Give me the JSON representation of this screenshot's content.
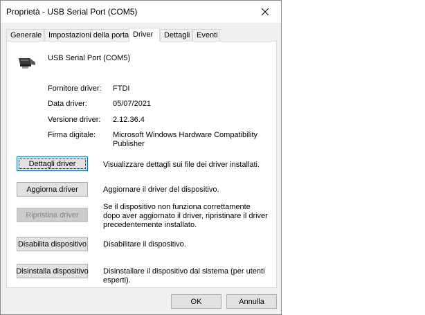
{
  "window": {
    "title": "Proprietà - USB Serial Port (COM5)",
    "close_icon": "close-icon"
  },
  "tabs": [
    {
      "label": "Generale"
    },
    {
      "label": "Impostazioni della porta"
    },
    {
      "label": "Driver",
      "selected": true
    },
    {
      "label": "Dettagli"
    },
    {
      "label": "Eventi"
    }
  ],
  "device": {
    "name": "USB Serial Port (COM5)",
    "icon": "usb-connector-icon"
  },
  "properties": [
    {
      "label": "Fornitore driver:",
      "value": "FTDI"
    },
    {
      "label": "Data driver:",
      "value": "05/07/2021"
    },
    {
      "label": "Versione driver:",
      "value": "2.12.36.4"
    },
    {
      "label": "Firma digitale:",
      "value": "Microsoft Windows Hardware Compatibility Publisher"
    }
  ],
  "actions": [
    {
      "label": "Dettagli driver",
      "description": "Visualizzare dettagli sui file dei driver installati.",
      "focused": true
    },
    {
      "label": "Aggiorna driver",
      "description": "Aggiornare il driver del dispositivo."
    },
    {
      "label": "Ripristina driver",
      "description": "Se il dispositivo non funziona correttamente dopo aver aggiornato il driver, ripristinare il driver precedentemente installato.",
      "disabled": true
    },
    {
      "label": "Disabilita dispositivo",
      "description": "Disabilitare il dispositivo."
    },
    {
      "label": "Disinstalla dispositivo",
      "description": "Disinstallare il dispositivo dal sistema (per utenti esperti)."
    }
  ],
  "footer": {
    "ok_label": "OK",
    "cancel_label": "Annulla"
  },
  "colors": {
    "dialog_bg": "#f0f0f0",
    "focus_border": "#0078d7",
    "disabled_text": "#838383"
  }
}
